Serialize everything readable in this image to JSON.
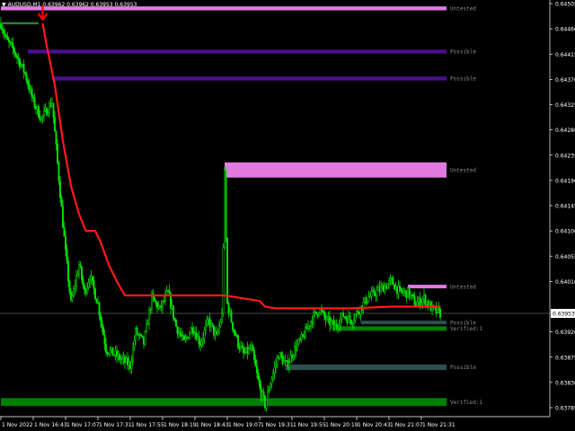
{
  "header": {
    "symbol_text": "AUDUSD,M1  0.63962 0.63962 0.63953 0.63953"
  },
  "chart_data": {
    "type": "candlestick",
    "y_ticks": [
      "0.64505",
      "0.64460",
      "0.64415",
      "0.64370",
      "0.64325",
      "0.64280",
      "0.64235",
      "0.64190",
      "0.64145",
      "0.64100",
      "0.64055",
      "0.64010",
      "0.63953",
      "0.63920",
      "0.63875",
      "0.63830",
      "0.63785"
    ],
    "y_tick_values": [
      0.64505,
      0.6446,
      0.64415,
      0.6437,
      0.64325,
      0.6428,
      0.64235,
      0.6419,
      0.64145,
      0.641,
      0.64055,
      0.6401,
      0.63953,
      0.6392,
      0.63875,
      0.6383,
      0.63785
    ],
    "current_price_label": "0.63953",
    "current_price": 0.63953,
    "x_ticks": [
      "1 Nov 2022",
      "1 Nov 16:43",
      "1 Nov 17:07",
      "1 Nov 17:31",
      "1 Nov 17:55",
      "1 Nov 18:19",
      "1 Nov 18:43",
      "1 Nov 19:07",
      "1 Nov 19:31",
      "1 Nov 19:55",
      "1 Nov 20:19",
      "1 Nov 20:43",
      "1 Nov 21:07",
      "1 Nov 21:31"
    ],
    "x_tick_index": [
      0,
      24,
      48,
      72,
      96,
      120,
      144,
      168,
      192,
      216,
      240,
      264,
      288,
      312
    ],
    "n_bars": 327,
    "price_path": [
      [
        0,
        0.6447
      ],
      [
        4,
        0.6444
      ],
      [
        10,
        0.6442
      ],
      [
        18,
        0.6438
      ],
      [
        24,
        0.6433
      ],
      [
        30,
        0.643
      ],
      [
        38,
        0.6433
      ],
      [
        42,
        0.6422
      ],
      [
        48,
        0.6406
      ],
      [
        52,
        0.6397
      ],
      [
        58,
        0.6404
      ],
      [
        62,
        0.6399
      ],
      [
        66,
        0.6402
      ],
      [
        72,
        0.6397
      ],
      [
        78,
        0.6389
      ],
      [
        84,
        0.6388
      ],
      [
        90,
        0.6387
      ],
      [
        96,
        0.6386
      ],
      [
        100,
        0.6392
      ],
      [
        106,
        0.639
      ],
      [
        112,
        0.6398
      ],
      [
        118,
        0.6396
      ],
      [
        124,
        0.6399
      ],
      [
        130,
        0.6393
      ],
      [
        136,
        0.639
      ],
      [
        142,
        0.6393
      ],
      [
        148,
        0.639
      ],
      [
        154,
        0.6394
      ],
      [
        160,
        0.6391
      ],
      [
        164,
        0.6395
      ],
      [
        166,
        0.642
      ],
      [
        168,
        0.6397
      ],
      [
        172,
        0.6393
      ],
      [
        176,
        0.639
      ],
      [
        180,
        0.6388
      ],
      [
        186,
        0.6389
      ],
      [
        192,
        0.6382
      ],
      [
        196,
        0.6379
      ],
      [
        200,
        0.6383
      ],
      [
        206,
        0.6388
      ],
      [
        212,
        0.6386
      ],
      [
        218,
        0.6389
      ],
      [
        224,
        0.6391
      ],
      [
        230,
        0.6394
      ],
      [
        236,
        0.6396
      ],
      [
        242,
        0.6394
      ],
      [
        248,
        0.6393
      ],
      [
        254,
        0.6395
      ],
      [
        260,
        0.6394
      ],
      [
        266,
        0.6396
      ],
      [
        272,
        0.6398
      ],
      [
        278,
        0.6399
      ],
      [
        284,
        0.64
      ],
      [
        290,
        0.6401
      ],
      [
        296,
        0.6399
      ],
      [
        302,
        0.6399
      ],
      [
        308,
        0.6397
      ],
      [
        314,
        0.6398
      ],
      [
        320,
        0.6396
      ],
      [
        326,
        0.63953
      ]
    ],
    "ma_path": [
      [
        31,
        0.6447
      ],
      [
        34,
        0.6443
      ],
      [
        40,
        0.6436
      ],
      [
        46,
        0.6426
      ],
      [
        52,
        0.6418
      ],
      [
        58,
        0.6413
      ],
      [
        63,
        0.641
      ],
      [
        70,
        0.641
      ],
      [
        74,
        0.6408
      ],
      [
        80,
        0.6404
      ],
      [
        86,
        0.6401
      ],
      [
        92,
        0.63985
      ],
      [
        100,
        0.63985
      ],
      [
        140,
        0.63985
      ],
      [
        166,
        0.63985
      ],
      [
        192,
        0.63975
      ],
      [
        196,
        0.63965
      ],
      [
        204,
        0.63962
      ],
      [
        230,
        0.63962
      ],
      [
        260,
        0.63962
      ],
      [
        290,
        0.63965
      ],
      [
        326,
        0.63965
      ]
    ],
    "zones": [
      {
        "label": "Untested",
        "y_top": 0.645,
        "y_bottom": 0.64493,
        "start_bar": 0,
        "color": "#e07ae0"
      },
      {
        "label": "Possible",
        "y_top": 0.64423,
        "y_bottom": 0.64416,
        "start_bar": 20,
        "color": "#4b0e8c"
      },
      {
        "label": "Possible",
        "y_top": 0.64375,
        "y_bottom": 0.64368,
        "start_bar": 38,
        "color": "#4b0e8c"
      },
      {
        "label": "Untested",
        "y_top": 0.64222,
        "y_bottom": 0.64195,
        "start_bar": 166,
        "color": "#e07ae0"
      },
      {
        "label": "Untested",
        "y_top": 0.64004,
        "y_bottom": 0.63998,
        "start_bar": 302,
        "color": "#e07ae0"
      },
      {
        "label": "Possible",
        "y_top": 0.6394,
        "y_bottom": 0.63936,
        "start_bar": 267,
        "color": "#2f4f4f"
      },
      {
        "label": "Verified:1",
        "y_top": 0.6393,
        "y_bottom": 0.63922,
        "start_bar": 246,
        "color": "#008000"
      },
      {
        "label": "Possible",
        "y_top": 0.63862,
        "y_bottom": 0.63852,
        "start_bar": 211,
        "color": "#2f4f4f"
      },
      {
        "label": "Verified:1",
        "y_top": 0.63802,
        "y_bottom": 0.63788,
        "start_bar": 0,
        "color": "#008000"
      }
    ],
    "arrow": {
      "bar": 31,
      "price": 0.6447,
      "color": "#ff0000"
    },
    "green_tick": {
      "start_bar": 0,
      "end_bar": 28,
      "price": 0.6447
    }
  }
}
